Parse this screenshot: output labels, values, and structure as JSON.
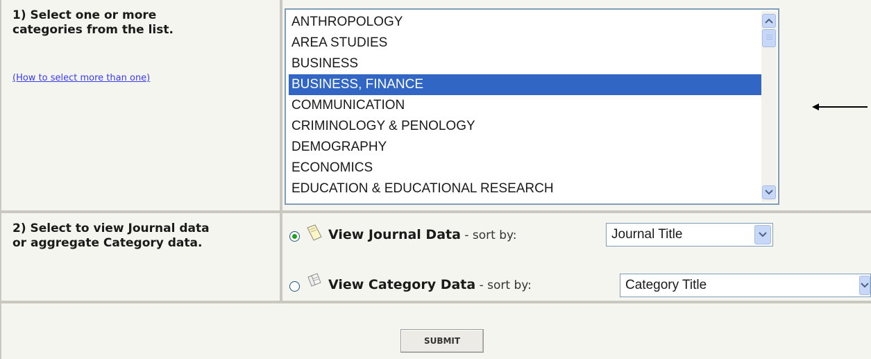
{
  "step1": {
    "heading_line1": "1) Select one or more",
    "heading_line2": "categories from the list.",
    "help_link": "(How to select more than one)",
    "categories": [
      "ANTHROPOLOGY",
      "AREA STUDIES",
      "BUSINESS",
      "BUSINESS, FINANCE",
      "COMMUNICATION",
      "CRIMINOLOGY & PENOLOGY",
      "DEMOGRAPHY",
      "ECONOMICS",
      "EDUCATION & EDUCATIONAL RESEARCH"
    ],
    "selected_category": "BUSINESS, FINANCE"
  },
  "step2": {
    "heading_line1": "2) Select to view Journal data",
    "heading_line2": "or aggregate Category data.",
    "journal_option": {
      "label": "View Journal Data",
      "sort_text": " - sort by:",
      "sort_value": "Journal Title",
      "checked": true,
      "icon": "journal-page-icon"
    },
    "category_option": {
      "label": "View Category Data",
      "sort_text": " - sort by:",
      "sort_value": "Category Title",
      "checked": false,
      "icon": "category-pages-icon"
    }
  },
  "submit_label": "SUBMIT",
  "colors": {
    "selection": "#3166c4",
    "panel": "#f5f5ef",
    "link": "#3a3aef",
    "radio_dot": "#21a121"
  }
}
